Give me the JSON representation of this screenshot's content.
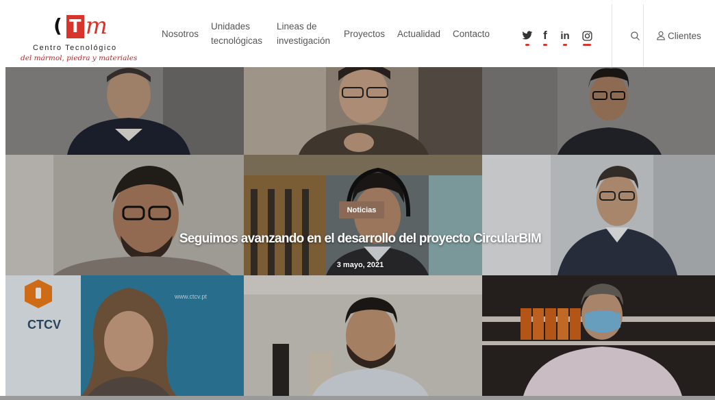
{
  "logo": {
    "paren": "(",
    "letter_t": "T",
    "letter_m": "m",
    "line1": "Centro Tecnológico",
    "line2": "del mármol, piedra y materiales"
  },
  "nav": {
    "items": [
      {
        "line1": "Nosotros",
        "line2": ""
      },
      {
        "line1": "Unidades",
        "line2": "tecnológicas"
      },
      {
        "line1": "Lineas de",
        "line2": "investigación"
      },
      {
        "line1": "Proyectos",
        "line2": ""
      },
      {
        "line1": "Actualidad",
        "line2": ""
      },
      {
        "line1": "Contacto",
        "line2": ""
      }
    ]
  },
  "social": {
    "icons": [
      "twitter-icon",
      "facebook-icon",
      "linkedin-icon",
      "instagram-icon"
    ],
    "linkedin_text": "in",
    "facebook_text": "f"
  },
  "search": {
    "icon": "search-icon"
  },
  "clients": {
    "label": "Clientes",
    "icon": "user-icon"
  },
  "hero": {
    "category": "Noticias",
    "title": "Seguimos avanzando en el desarrollo del proyecto CircularBIM",
    "date": "3 mayo, 2021",
    "tile4_text": "CTCV",
    "tile4_url": "www.ctcv.pt"
  },
  "colors": {
    "brand_red": "#d9342b",
    "nav_text": "#555555",
    "badge_bg": "#8a6a56"
  }
}
